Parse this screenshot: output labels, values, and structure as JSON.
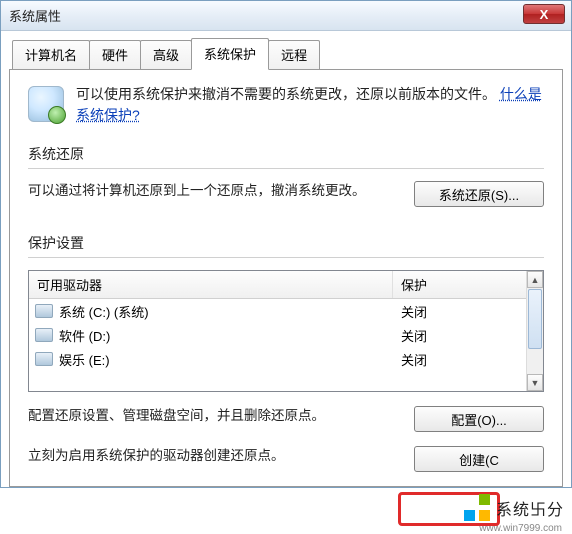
{
  "window": {
    "title": "系统属性",
    "close_glyph": "X"
  },
  "tabs": {
    "computer_name": "计算机名",
    "hardware": "硬件",
    "advanced": "高级",
    "system_protection": "系统保护",
    "remote": "远程"
  },
  "intro": {
    "text_before": "可以使用系统保护来撤消不需要的系统更改，还原以前版本的文件。",
    "link": "什么是系统保护?"
  },
  "restore_group": {
    "title": "系统还原",
    "desc": "可以通过将计算机还原到上一个还原点，撤消系统更改。",
    "button": "系统还原(S)..."
  },
  "protect_group": {
    "title": "保护设置",
    "header_drive": "可用驱动器",
    "header_protection": "保护",
    "drives": [
      {
        "label": "系统 (C:) (系统)",
        "status": "关闭"
      },
      {
        "label": "软件 (D:)",
        "status": "关闭"
      },
      {
        "label": "娱乐 (E:)",
        "status": "关闭"
      }
    ],
    "config_desc": "配置还原设置、管理磁盘空间，并且删除还原点。",
    "config_button": "配置(O)...",
    "create_desc": "立刻为启用系统保护的驱动器创建还原点。",
    "create_button": "创建(C"
  },
  "watermark": {
    "brand": "系统卐分",
    "url": "www.win7999.com"
  }
}
